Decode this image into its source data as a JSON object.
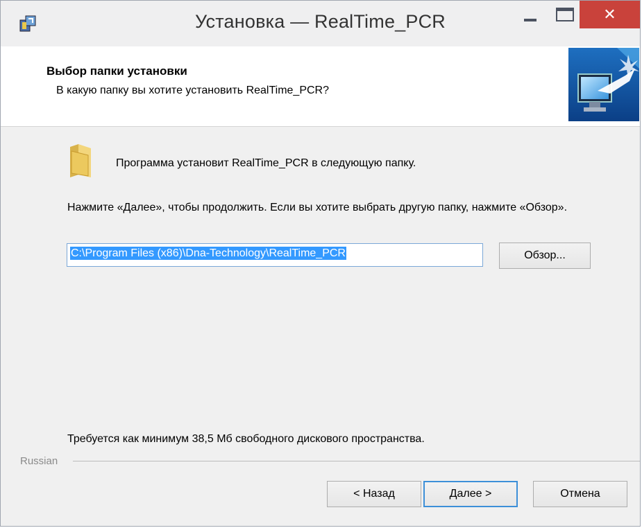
{
  "window": {
    "title": "Установка — RealTime_PCR",
    "close_glyph": "✕",
    "colors": {
      "close_bg": "#c9423b",
      "selection": "#3399ff"
    }
  },
  "header": {
    "title": "Выбор папки установки",
    "subtitle": "В какую папку вы хотите установить RealTime_PCR?",
    "image_icon": "monitor-install-icon"
  },
  "body": {
    "folder_icon": "folder-icon",
    "intro": "Программа установит RealTime_PCR в следующую папку.",
    "instructions": "Нажмите «Далее», чтобы продолжить. Если вы хотите выбрать другую папку, нажмите «Обзор».",
    "path_value": "C:\\Program Files (x86)\\Dna-Technology\\RealTime_PCR",
    "browse_label": "Обзор...",
    "space_required": "Требуется как минимум 38,5 Мб свободного дискового пространства."
  },
  "footer": {
    "language": "Russian",
    "back_label": "< Назад",
    "next_label": "Далее >",
    "cancel_label": "Отмена"
  }
}
